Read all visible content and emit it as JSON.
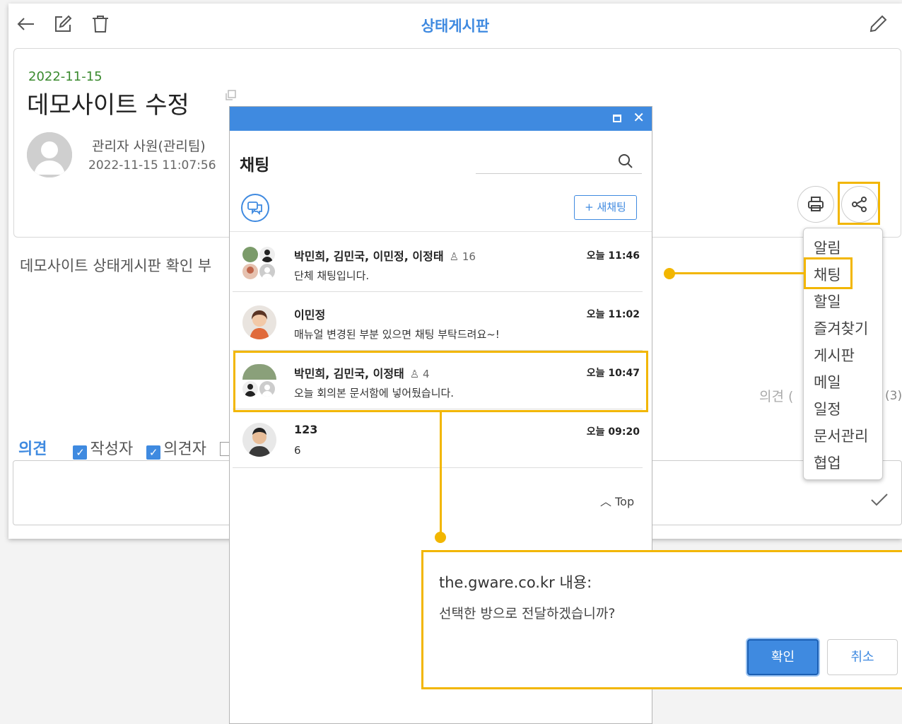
{
  "board": {
    "title": "상태게시판",
    "post": {
      "date": "2022-11-15",
      "title": "데모사이트 수정",
      "author": "관리자 사원(관리팀)",
      "timestamp": "2022-11-15 11:07:56",
      "body": "데모사이트 상태게시판 확인 부"
    },
    "opinion_right": "의견 (",
    "opinion_count": "(3)",
    "comment_bar": {
      "label": "의견",
      "filter_author": "작성자",
      "filter_commenter": "의견자"
    }
  },
  "share_menu": {
    "items": [
      "알림",
      "채팅",
      "할일",
      "즐겨찾기",
      "게시판",
      "메일",
      "일정",
      "문서관리",
      "협업"
    ],
    "highlighted": "채팅"
  },
  "chat": {
    "title": "채팅",
    "new_chat_label": "+ 새채팅",
    "top_label": "Top",
    "rooms": [
      {
        "name": "박민희, 김민국, 이민정, 이정태",
        "count": "16",
        "time": "오늘 11:46",
        "message": "단체 채팅입니다."
      },
      {
        "name": "이민정",
        "count": "",
        "time": "오늘 11:02",
        "message": "매뉴얼 변경된 부분 있으면 채팅 부탁드려요~!"
      },
      {
        "name": "박민희, 김민국, 이정태",
        "count": "4",
        "time": "오늘 10:47",
        "message": "오늘 회의본 문서함에 넣어뒀습니다."
      },
      {
        "name": "123",
        "count": "",
        "time": "오늘 09:20",
        "message": "6"
      }
    ]
  },
  "dialog": {
    "title": "the.gware.co.kr 내용:",
    "message": "선택한 방으로 전달하겠습니까?",
    "ok_label": "확인",
    "cancel_label": "취소"
  },
  "colors": {
    "accent": "#3f8ae0",
    "highlight": "#f2b600",
    "date_green": "#3a8a2e"
  }
}
